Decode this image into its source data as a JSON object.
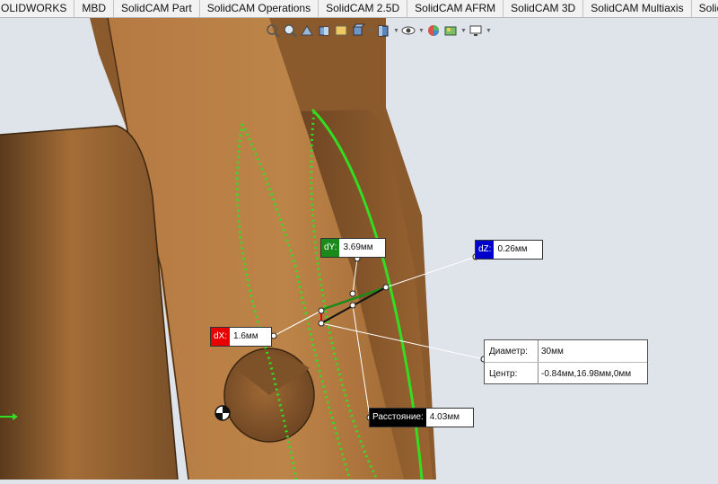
{
  "tabs": [
    "OLIDWORKS",
    "MBD",
    "SolidCAM Part",
    "SolidCAM Operations",
    "SolidCAM 2.5D",
    "SolidCAM AFRM",
    "SolidCAM 3D",
    "SolidCAM Multiaxis",
    "SolidCAM Tur"
  ],
  "headsup_icons": [
    "zoom-to-fit-icon",
    "zoom-area-icon",
    "previous-view-icon",
    "section-view-icon",
    "dynamic-annotation-icon",
    "view-orientation-icon",
    "display-style-icon",
    "hide-show-icon",
    "edit-appearance-icon",
    "apply-scene-icon",
    "view-settings-icon"
  ],
  "measure": {
    "dx_key": "dX:",
    "dx_val": "1.6мм",
    "dy_key": "dY:",
    "dy_val": "3.69мм",
    "dz_key": "dZ:",
    "dz_val": "0.26мм",
    "diameter_label": "Диаметр:",
    "diameter_val": "30мм",
    "center_label": "Центр:",
    "center_val": "-0.84мм,16.98мм,0мм",
    "distance_label": "Расстояние:",
    "distance_val": "4.03мм"
  },
  "colors": {
    "part": "#b87a3f",
    "selection": "#33dd22",
    "dx": "#e80000",
    "dy": "#1a8a1a",
    "dz": "#0000cc"
  }
}
